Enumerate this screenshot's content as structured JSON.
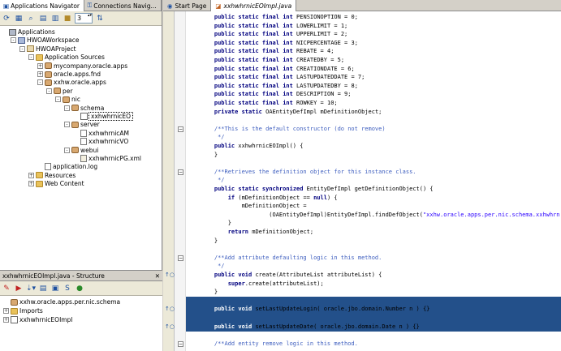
{
  "left_tabs": [
    {
      "label": "Applications Navigator",
      "active": true
    },
    {
      "label": "Connections Navig...",
      "active": false
    }
  ],
  "toolbar": {
    "spinner_value": "3"
  },
  "tree": [
    {
      "label": "Applications",
      "depth": 0,
      "icon": "app",
      "expand": ""
    },
    {
      "label": "HWOAWorkspace",
      "depth": 1,
      "icon": "ws",
      "expand": "-"
    },
    {
      "label": "HWOAProject",
      "depth": 2,
      "icon": "proj",
      "expand": "-"
    },
    {
      "label": "Application Sources",
      "depth": 3,
      "icon": "folder",
      "expand": "-"
    },
    {
      "label": "mycompany.oracle.apps",
      "depth": 4,
      "icon": "pkg",
      "expand": "+"
    },
    {
      "label": "oracle.apps.fnd",
      "depth": 4,
      "icon": "pkg",
      "expand": "+"
    },
    {
      "label": "xxhw.oracle.apps",
      "depth": 4,
      "icon": "pkg",
      "expand": "-"
    },
    {
      "label": "per",
      "depth": 5,
      "icon": "pkg",
      "expand": "-"
    },
    {
      "label": "nic",
      "depth": 6,
      "icon": "pkg",
      "expand": "-"
    },
    {
      "label": "schema",
      "depth": 7,
      "icon": "pkg",
      "expand": "-"
    },
    {
      "label": "xxhwhrnicEO",
      "depth": 8,
      "icon": "eo",
      "expand": "",
      "selected": true
    },
    {
      "label": "server",
      "depth": 7,
      "icon": "pkg",
      "expand": "-"
    },
    {
      "label": "xxhwhrnicAM",
      "depth": 8,
      "icon": "file",
      "expand": ""
    },
    {
      "label": "xxhwhrnicVO",
      "depth": 8,
      "icon": "file",
      "expand": ""
    },
    {
      "label": "webui",
      "depth": 7,
      "icon": "pkg",
      "expand": "-"
    },
    {
      "label": "xxhwhrnicPG.xml",
      "depth": 8,
      "icon": "xml",
      "expand": ""
    },
    {
      "label": "application.log",
      "depth": 4,
      "icon": "file",
      "expand": ""
    },
    {
      "label": "Resources",
      "depth": 3,
      "icon": "folder",
      "expand": "+"
    },
    {
      "label": "Web Content",
      "depth": 3,
      "icon": "folder",
      "expand": "+"
    }
  ],
  "structure": {
    "title": "xxhwhrnicEOImpl.java - Structure",
    "items": [
      {
        "label": "xxhw.oracle.apps.per.nic.schema",
        "depth": 0,
        "expand": ""
      },
      {
        "label": "Imports",
        "depth": 0,
        "expand": "+"
      },
      {
        "label": "xxhwhrnicEOImpl",
        "depth": 0,
        "expand": "+"
      }
    ]
  },
  "editor_tabs": [
    {
      "label": "Start Page",
      "active": false
    },
    {
      "label": "xxhwhrnicEOImpl.java",
      "active": true
    }
  ],
  "code_lines": [
    {
      "text": "    public static final int PENSIONOPTION = 0;",
      "kind": "code"
    },
    {
      "text": "    public static final int LOWERLIMIT = 1;",
      "kind": "code"
    },
    {
      "text": "    public static final int UPPERLIMIT = 2;",
      "kind": "code"
    },
    {
      "text": "    public static final int NICPERCENTAGE = 3;",
      "kind": "code"
    },
    {
      "text": "    public static final int REBATE = 4;",
      "kind": "code"
    },
    {
      "text": "    public static final int CREATEDBY = 5;",
      "kind": "code"
    },
    {
      "text": "    public static final int CREATIONDATE = 6;",
      "kind": "code"
    },
    {
      "text": "    public static final int LASTUPDATEDDATE = 7;",
      "kind": "code"
    },
    {
      "text": "    public static final int LASTUPDATEDBY = 8;",
      "kind": "code"
    },
    {
      "text": "    public static final int DESCRIPTION = 9;",
      "kind": "code"
    },
    {
      "text": "    public static final int ROWKEY = 10;",
      "kind": "code"
    },
    {
      "text": "    private static OAEntityDefImpl mDefinitionObject;",
      "kind": "code"
    },
    {
      "text": "",
      "kind": "blank"
    },
    {
      "text": "    /**This is the default constructor (do not remove)",
      "kind": "comment",
      "fold": true
    },
    {
      "text": "     */",
      "kind": "comment"
    },
    {
      "text": "    public xxhwhrnicEOImpl() {",
      "kind": "code"
    },
    {
      "text": "    }",
      "kind": "code"
    },
    {
      "text": "",
      "kind": "blank"
    },
    {
      "text": "    /**Retrieves the definition object for this instance class.",
      "kind": "comment",
      "fold": true
    },
    {
      "text": "     */",
      "kind": "comment"
    },
    {
      "text": "    public static synchronized EntityDefImpl getDefinitionObject() {",
      "kind": "code"
    },
    {
      "text": "        if (mDefinitionObject == null) {",
      "kind": "code"
    },
    {
      "text": "            mDefinitionObject =",
      "kind": "code"
    },
    {
      "text": "                    (OAEntityDefImpl)EntityDefImpl.findDefObject(\"xxhw.oracle.apps.per.nic.schema.xxhwhrn",
      "kind": "code"
    },
    {
      "text": "        }",
      "kind": "code"
    },
    {
      "text": "        return mDefinitionObject;",
      "kind": "code"
    },
    {
      "text": "    }",
      "kind": "code"
    },
    {
      "text": "",
      "kind": "blank"
    },
    {
      "text": "    /**Add attribute defaulting logic in this method.",
      "kind": "comment",
      "fold": true
    },
    {
      "text": "     */",
      "kind": "comment"
    },
    {
      "text": "    public void create(AttributeList attributeList) {",
      "kind": "code",
      "mark": true
    },
    {
      "text": "        super.create(attributeList);",
      "kind": "code"
    },
    {
      "text": "    }",
      "kind": "code"
    },
    {
      "text": "",
      "kind": "hl"
    },
    {
      "text": "    public void setLastUpdateLogin( oracle.jbo.domain.Number n ) {}",
      "kind": "hl",
      "mark": true
    },
    {
      "text": "",
      "kind": "hl"
    },
    {
      "text": "    public void setLastUpdateDate( oracle.jbo.domain.Date n ) {}",
      "kind": "hl",
      "mark": true
    },
    {
      "text": "",
      "kind": "blank"
    },
    {
      "text": "    /**Add entity remove logic in this method.",
      "kind": "comment",
      "fold": true
    }
  ]
}
